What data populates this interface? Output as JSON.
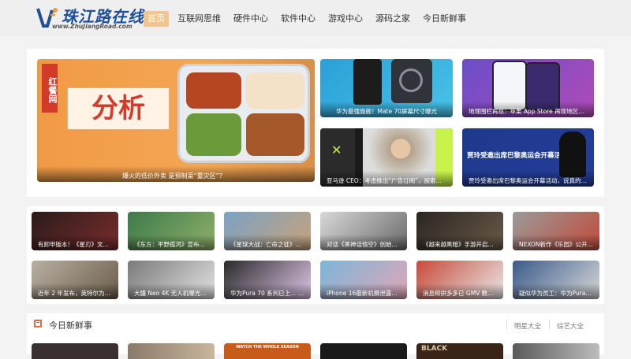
{
  "brand": {
    "name": "珠江路在线",
    "url": "www.ZhuJiangRoad.com",
    "color": "#1d4f9a"
  },
  "nav": {
    "items": [
      "首页",
      "互联网思维",
      "硬件中心",
      "软件中心",
      "游戏中心",
      "源码之家",
      "今日新鲜事"
    ],
    "active_index": 0,
    "active_color": "#f4c48e"
  },
  "featured": {
    "hero": {
      "caption": "爆火的低价外卖 是预制菜“重灾区”？",
      "badge": "红餐网",
      "headline": "分析"
    },
    "tiles": [
      {
        "caption": "华为最强旗舰！Mate 70屏幕尺寸曝光"
      },
      {
        "caption": "地理围栏再现：苹果 App Store 再现地区流..."
      },
      {
        "caption": "亚马逊 CEO：考虑推出“广告订阅”，探索订阅..."
      },
      {
        "caption": "贾玲受邀出席巴黎奥运会开幕活动，说真的，内娱只有..."
      }
    ],
    "tile_headline_3": "贾玲受邀出席巴黎奥运会开幕活动"
  },
  "news_grid": [
    {
      "caption": "有卸甲版本！《星刃》文..."
    },
    {
      "caption": "《东方：平野孤鸿》宣布1..."
    },
    {
      "caption": "《星球大战：亡命之徒》..."
    },
    {
      "caption": "对话《黑神话悟空》创始团..."
    },
    {
      "caption": "《越来越黑暗》手游开启..."
    },
    {
      "caption": "NEXON新作《乐园》公开..."
    },
    {
      "caption": "近年 2 年发布，英特尔为..."
    },
    {
      "caption": "大疆 Neo 4K 无人机曝光..."
    },
    {
      "caption": "华为Pura 70 系列已上... All..."
    },
    {
      "caption": "iPhone 16最新机模泄露曝..."
    },
    {
      "caption": "消息称拼多多已 GMV 数..."
    },
    {
      "caption": "疑似华为员工：华为Pura 70..."
    }
  ],
  "section": {
    "title": "今日新鲜事",
    "links": [
      "明星大全",
      "综艺大全"
    ]
  },
  "bottom_strip": {
    "caption_2": "WATCH THE WHOLE SEASON",
    "caption_4": "BLACK"
  }
}
